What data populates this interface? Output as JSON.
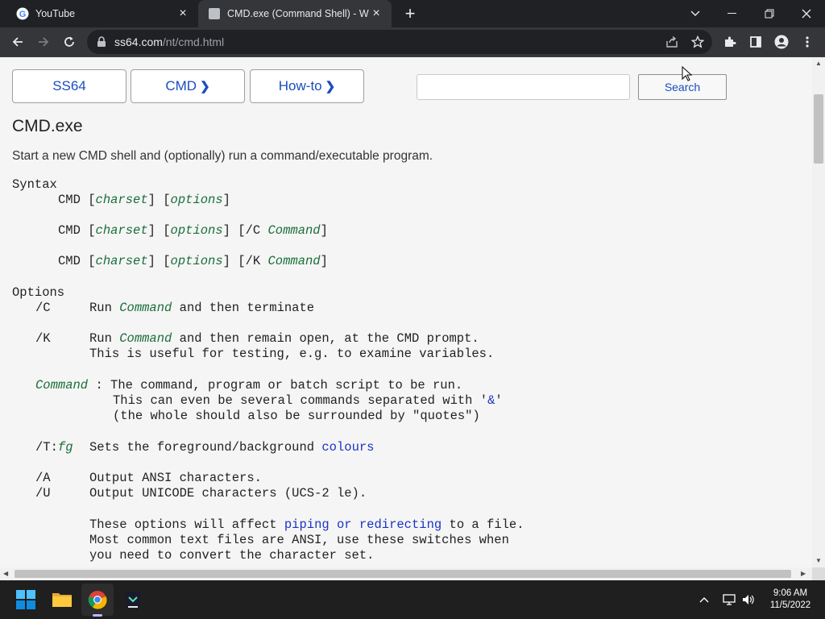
{
  "browser": {
    "tabs": [
      {
        "title": "YouTube",
        "active": false
      },
      {
        "title": "CMD.exe (Command Shell) - Win",
        "active": true
      }
    ],
    "address": {
      "domain": "ss64.com",
      "path": "/nt/cmd.html"
    }
  },
  "page": {
    "nav": [
      {
        "label": "SS64",
        "chevron": ""
      },
      {
        "label": "CMD",
        "chevron": "❯"
      },
      {
        "label": "How-to",
        "chevron": "❯"
      }
    ],
    "search": {
      "value": "",
      "button": "Search"
    },
    "title": "CMD.exe",
    "intro": "Start a new CMD shell and (optionally) run a command/executable program.",
    "syntax_heading": "Syntax",
    "syntax_cmd": "CMD",
    "syntax_charset": "charset",
    "syntax_options": "options",
    "syntax_c": "/C",
    "syntax_k": "/K",
    "syntax_command": "Command",
    "options_heading": "Options",
    "opt_c": {
      "switch": "/C",
      "pre": "Run",
      "arg": "Command",
      "post": "and then terminate"
    },
    "opt_k": {
      "switch": "/K",
      "pre": "Run",
      "arg": "Command",
      "post": "and then remain open, at the CMD prompt.",
      "line2": "This is useful for testing, e.g. to examine variables."
    },
    "opt_command": {
      "arg": "Command",
      "line1": ": The command, program or batch script to be run.",
      "line2a": "This can even be several commands separated with '",
      "amp": "&",
      "line2b": "'",
      "line3": "(the whole should also be surrounded by \"quotes\")"
    },
    "opt_t": {
      "switch": "/T:",
      "arg": "fg",
      "pre": "Sets the foreground/background",
      "link": "colours"
    },
    "opt_a": {
      "switch": "/A",
      "text": "Output ANSI characters."
    },
    "opt_u": {
      "switch": "/U",
      "text": "Output UNICODE characters (UCS-2 le)."
    },
    "note": {
      "line1_pre": "These options will affect",
      "link": "piping or redirecting",
      "line1_post": "to a file.",
      "line2": "Most common text files are ANSI, use these switches when",
      "line3": "you need to convert the character set."
    }
  },
  "taskbar": {
    "time": "9:06 AM",
    "date": "11/5/2022"
  }
}
